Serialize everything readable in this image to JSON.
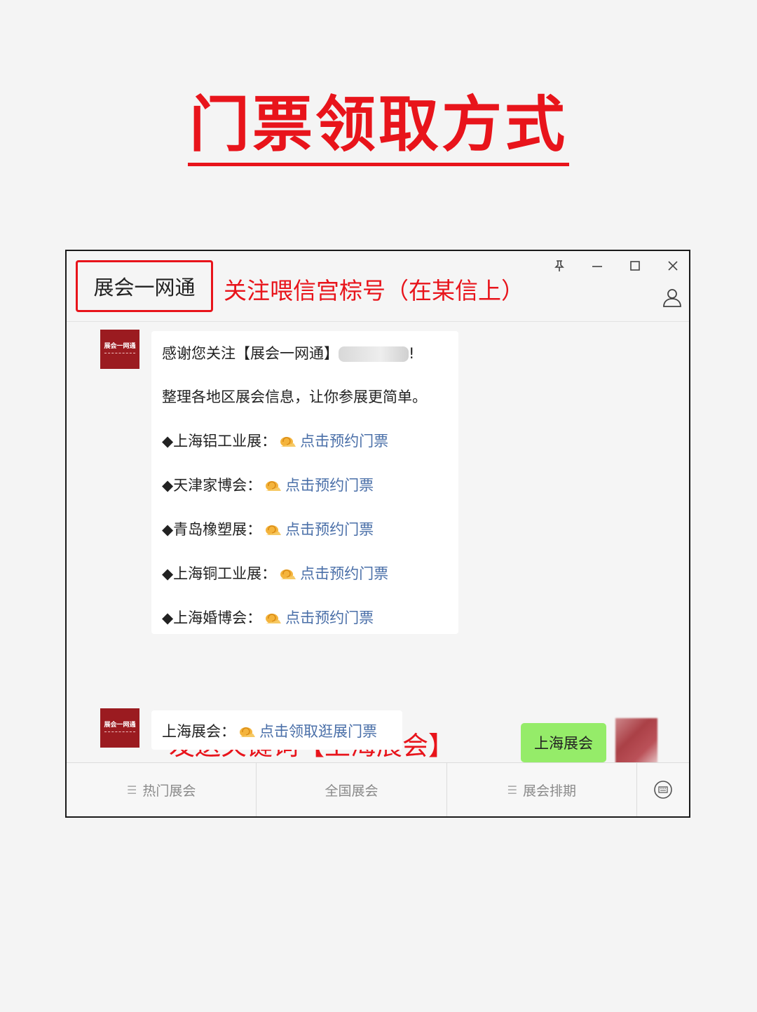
{
  "headline": "门票领取方式",
  "window": {
    "account_name": "展会一网通",
    "account_note": "关注喂信宫棕号（在某信上）"
  },
  "welcome_message": {
    "greeting_prefix": "感谢您关注【展会一网通】",
    "greeting_suffix": "!",
    "intro": "整理各地区展会信息，让你参展更简单。",
    "items": [
      {
        "name": "◆上海铝工业展：",
        "link": "点击预约门票"
      },
      {
        "name": "◆天津家博会：",
        "link": "点击预约门票"
      },
      {
        "name": "◆青岛橡塑展：",
        "link": "点击预约门票"
      },
      {
        "name": "◆上海铜工业展：",
        "link": "点击预约门票"
      },
      {
        "name": "◆上海婚博会：",
        "link": "点击预约门票"
      }
    ]
  },
  "instruction": "发送关键词【上海展会】",
  "user_message": "上海展会",
  "reply_message": {
    "prefix": "上海展会：",
    "link": "点击领取逛展门票"
  },
  "avatar_text": "展会一网通",
  "tabs": [
    "热门展会",
    "全国展会",
    "展会排期"
  ],
  "icons": [
    "pin-icon",
    "minimize-icon",
    "maximize-icon",
    "close-icon",
    "user-icon",
    "snail-icon",
    "menu-icon",
    "keyboard-icon",
    "arrow-icon"
  ],
  "colors": {
    "accent_red": "#e8141b",
    "user_bubble": "#95ec69",
    "link": "#4a6fa8",
    "avatar": "#9b1b20"
  }
}
